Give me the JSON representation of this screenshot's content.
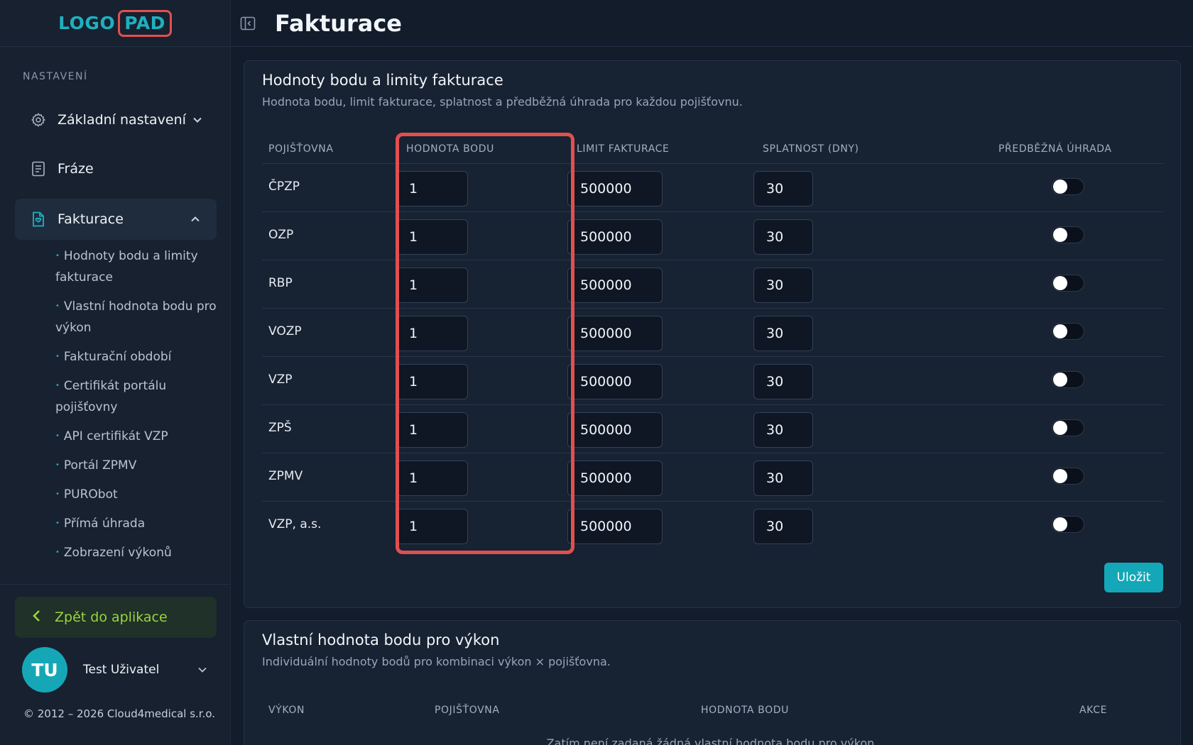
{
  "logo": {
    "part1": "LOGO",
    "part2": "PAD"
  },
  "sidebar": {
    "section_title": "NASTAVENÍ",
    "items": [
      {
        "label": "Základní nastavení",
        "icon": "gear-icon"
      },
      {
        "label": "Fráze",
        "icon": "document-icon"
      },
      {
        "label": "Fakturace",
        "icon": "invoice-icon"
      }
    ],
    "sub_items": [
      "Hodnoty bodu a limity fakturace",
      "Vlastní hodnota bodu pro výkon",
      "Fakturační období",
      "Certifikát portálu pojišťovny",
      "API certifikát VZP",
      "Portál ZPMV",
      "PURObot",
      "Přímá úhrada",
      "Zobrazení výkonů"
    ],
    "back_label": "Zpět do aplikace",
    "user": {
      "initials": "TU",
      "name": "Test Uživatel"
    },
    "copyright": "© 2012 – 2026 Cloud4medical s.r.o."
  },
  "header": {
    "title": "Fakturace"
  },
  "card1": {
    "title": "Hodnoty bodu a limity fakturace",
    "subtitle": "Hodnota bodu, limit fakturace, splatnost a předběžná úhrada pro každou pojišťovnu.",
    "columns": [
      "POJIŠŤOVNA",
      "HODNOTA BODU",
      "LIMIT FAKTURACE",
      "SPLATNOST (DNY)",
      "PŘEDBĚŽNÁ ÚHRADA"
    ],
    "rows": [
      {
        "name": "ČPZP",
        "point_value": "1",
        "limit": "500000",
        "due": "30",
        "prepay": false
      },
      {
        "name": "OZP",
        "point_value": "1",
        "limit": "500000",
        "due": "30",
        "prepay": false
      },
      {
        "name": "RBP",
        "point_value": "1",
        "limit": "500000",
        "due": "30",
        "prepay": false
      },
      {
        "name": "VOZP",
        "point_value": "1",
        "limit": "500000",
        "due": "30",
        "prepay": false
      },
      {
        "name": "VZP",
        "point_value": "1",
        "limit": "500000",
        "due": "30",
        "prepay": false
      },
      {
        "name": "ZPŠ",
        "point_value": "1",
        "limit": "500000",
        "due": "30",
        "prepay": false
      },
      {
        "name": "ZPMV",
        "point_value": "1",
        "limit": "500000",
        "due": "30",
        "prepay": false
      },
      {
        "name": "VZP, a.s.",
        "point_value": "1",
        "limit": "500000",
        "due": "30",
        "prepay": false
      }
    ],
    "save_label": "Uložit"
  },
  "card2": {
    "title": "Vlastní hodnota bodu pro výkon",
    "subtitle": "Individuální hodnoty bodů pro kombinaci výkon × pojišťovna.",
    "columns": [
      "VÝKON",
      "POJIŠŤOVNA",
      "HODNOTA BODU",
      "AKCE"
    ],
    "empty_text": "Zatím není zadaná žádná vlastní hodnota bodu pro výkon."
  },
  "colors": {
    "accent": "#1fb0bf",
    "highlight": "#e0504f",
    "back_button_text": "#9bd43c"
  }
}
